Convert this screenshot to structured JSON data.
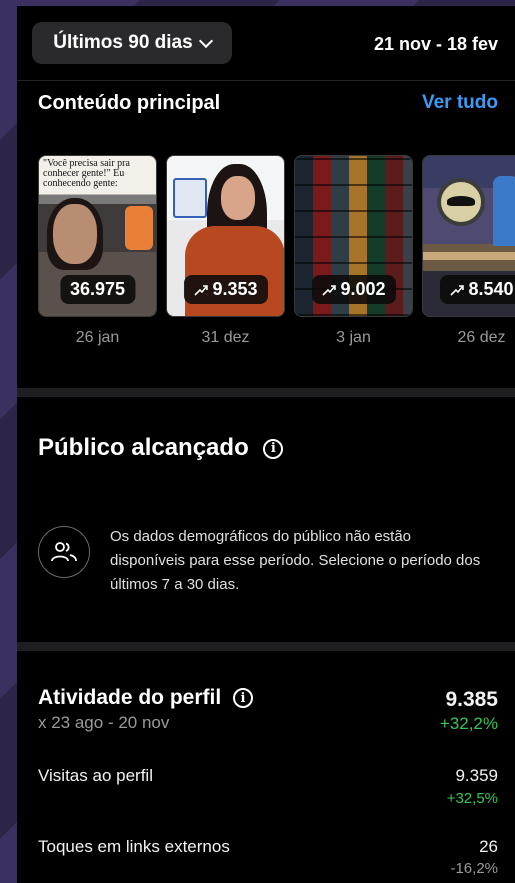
{
  "header": {
    "period_label": "Últimos 90 dias",
    "date_range": "21 nov - 18 fev"
  },
  "top_content": {
    "title": "Conteúdo principal",
    "see_all": "Ver tudo",
    "items": [
      {
        "caption": "\"Você precisa sair pra conhecer gente!\" Eu conhecendo gente:",
        "value": "36.975",
        "date": "26 jan",
        "trend_icon": false
      },
      {
        "value": "9.353",
        "date": "31 dez",
        "trend_icon": true
      },
      {
        "value": "9.002",
        "date": "3 jan",
        "trend_icon": true
      },
      {
        "value": "8.540",
        "date": "26 dez",
        "trend_icon": true
      }
    ]
  },
  "audience": {
    "title": "Público alcançado",
    "message": "Os dados demográficos do público não estão disponíveis para esse período. Selecione o período dos últimos 7 a 30 dias.",
    "icon": "people-icon"
  },
  "profile_activity": {
    "title": "Atividade do perfil",
    "compare_range": "x 23 ago - 20 nov",
    "total": "9.385",
    "total_change": "+32,2%",
    "rows": [
      {
        "label": "Visitas ao perfil",
        "value": "9.359",
        "change": "+32,5%"
      },
      {
        "label": "Toques em links externos",
        "value": "26",
        "change": "-16,2%"
      }
    ]
  },
  "colors": {
    "accent_link": "#3e9bf3",
    "positive": "#35c759",
    "negative": "#9a9a9a"
  }
}
